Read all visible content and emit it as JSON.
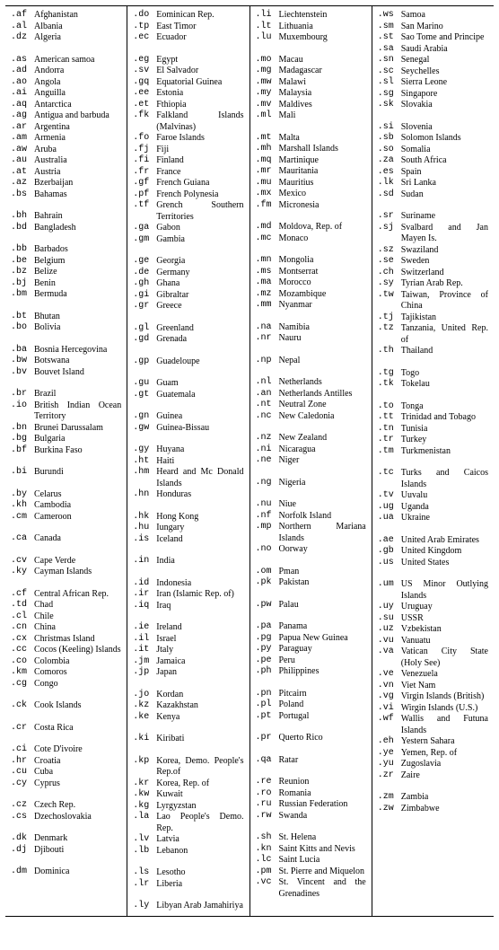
{
  "columns": [
    [
      {
        "code": ".af",
        "name": "Afghanistan"
      },
      {
        "code": ".al",
        "name": "Albania"
      },
      {
        "code": ".dz",
        "name": "Algeria"
      },
      {
        "gap": true
      },
      {
        "code": ".as",
        "name": "American samoa"
      },
      {
        "code": ".ad",
        "name": "Andorra"
      },
      {
        "code": ".ao",
        "name": "Angola"
      },
      {
        "code": ".ai",
        "name": "Anguilla"
      },
      {
        "code": ".aq",
        "name": "Antarctica"
      },
      {
        "code": ".ag",
        "name": "Antigua and bar­buda"
      },
      {
        "code": ".ar",
        "name": "Argentina"
      },
      {
        "code": ".am",
        "name": "Armenia"
      },
      {
        "code": ".aw",
        "name": "Aruba"
      },
      {
        "code": ".au",
        "name": "Australia"
      },
      {
        "code": ".at",
        "name": "Austria"
      },
      {
        "code": ".az",
        "name": "Bzerbaijan"
      },
      {
        "code": ".bs",
        "name": "Bahamas"
      },
      {
        "gap": true
      },
      {
        "code": ".bh",
        "name": "Bahrain"
      },
      {
        "code": ".bd",
        "name": "Bangladesh"
      },
      {
        "gap": true
      },
      {
        "code": ".bb",
        "name": "Barbados"
      },
      {
        "code": ".be",
        "name": "Belgium"
      },
      {
        "code": ".bz",
        "name": "Belize"
      },
      {
        "code": ".bj",
        "name": "Benin"
      },
      {
        "code": ".bm",
        "name": "Bermuda"
      },
      {
        "gap": true
      },
      {
        "code": ".bt",
        "name": "Bhutan"
      },
      {
        "code": ".bo",
        "name": "Bolivia"
      },
      {
        "gap": true
      },
      {
        "code": ".ba",
        "name": "Bosnia Hercegov­ina"
      },
      {
        "code": ".bw",
        "name": "Botswana"
      },
      {
        "code": ".bv",
        "name": "Bouvet Island"
      },
      {
        "gap": true
      },
      {
        "code": ".br",
        "name": "Brazil"
      },
      {
        "code": ".io",
        "name": "British Indian Ocean Territory"
      },
      {
        "code": ".bn",
        "name": "Brunei Darussalam"
      },
      {
        "code": ".bg",
        "name": "Bulgaria"
      },
      {
        "code": ".bf",
        "name": "Burkina Faso"
      },
      {
        "gap": true
      },
      {
        "code": ".bi",
        "name": "Burundi"
      },
      {
        "gap": true
      },
      {
        "code": ".by",
        "name": "Celarus"
      },
      {
        "code": ".kh",
        "name": "Cambodia"
      },
      {
        "code": ".cm",
        "name": "Cameroon"
      },
      {
        "gap": true
      },
      {
        "code": ".ca",
        "name": "Canada"
      },
      {
        "gap": true
      },
      {
        "code": ".cv",
        "name": "Cape Verde"
      },
      {
        "code": ".ky",
        "name": "Cayman Islands"
      },
      {
        "gap": true
      },
      {
        "code": ".cf",
        "name": "Central African Rep."
      },
      {
        "code": ".td",
        "name": "Chad"
      },
      {
        "code": ".cl",
        "name": "Chile"
      },
      {
        "code": ".cn",
        "name": "China"
      },
      {
        "code": ".cx",
        "name": "Christmas Island"
      },
      {
        "code": ".cc",
        "name": "Cocos (Keeling) Is­lands"
      },
      {
        "code": ".co",
        "name": "Colombia"
      },
      {
        "code": ".km",
        "name": "Comoros"
      },
      {
        "code": ".cg",
        "name": "Congo"
      },
      {
        "gap": true
      },
      {
        "code": ".ck",
        "name": "Cook Islands"
      },
      {
        "gap": true
      },
      {
        "code": ".cr",
        "name": "Costa Rica"
      },
      {
        "gap": true
      },
      {
        "code": ".ci",
        "name": "Cote D'ivoire"
      },
      {
        "code": ".hr",
        "name": "Croatia"
      },
      {
        "code": ".cu",
        "name": "Cuba"
      },
      {
        "code": ".cy",
        "name": "Cyprus"
      },
      {
        "gap": true
      },
      {
        "code": ".cz",
        "name": "Czech Rep."
      },
      {
        "code": ".cs",
        "name": "Dzechoslovakia"
      },
      {
        "gap": true
      },
      {
        "code": ".dk",
        "name": "Denmark"
      },
      {
        "code": ".dj",
        "name": "Djibouti"
      },
      {
        "gap": true
      },
      {
        "code": ".dm",
        "name": "Dominica"
      }
    ],
    [
      {
        "code": ".do",
        "name": "Eominican Rep."
      },
      {
        "code": ".tp",
        "name": "East Timor"
      },
      {
        "code": ".ec",
        "name": "Ecuador"
      },
      {
        "gap": true
      },
      {
        "code": ".eg",
        "name": "Egypt"
      },
      {
        "code": ".sv",
        "name": "El Salvador"
      },
      {
        "code": ".gq",
        "name": "Equatorial Guinea"
      },
      {
        "code": ".ee",
        "name": "Estonia"
      },
      {
        "code": ".et",
        "name": "Fthiopia"
      },
      {
        "code": ".fk",
        "name": "Falkland Islands (Malvinas)"
      },
      {
        "code": ".fo",
        "name": "Faroe Islands"
      },
      {
        "code": ".fj",
        "name": "Fiji"
      },
      {
        "code": ".fi",
        "name": "Finland"
      },
      {
        "code": ".fr",
        "name": "France"
      },
      {
        "code": ".gf",
        "name": "French Guiana"
      },
      {
        "code": ".pf",
        "name": "French Polynesia"
      },
      {
        "code": ".tf",
        "name": "Grench Southern Territories"
      },
      {
        "code": ".ga",
        "name": "Gabon"
      },
      {
        "code": ".gm",
        "name": "Gambia"
      },
      {
        "gap": true
      },
      {
        "code": ".ge",
        "name": "Georgia"
      },
      {
        "code": ".de",
        "name": "Germany"
      },
      {
        "code": ".gh",
        "name": "Ghana"
      },
      {
        "code": ".gi",
        "name": "Gibraltar"
      },
      {
        "code": ".gr",
        "name": "Greece"
      },
      {
        "gap": true
      },
      {
        "code": ".gl",
        "name": "Greenland"
      },
      {
        "code": ".gd",
        "name": "Grenada"
      },
      {
        "gap": true
      },
      {
        "code": ".gp",
        "name": "Guadeloupe"
      },
      {
        "gap": true
      },
      {
        "code": ".gu",
        "name": "Guam"
      },
      {
        "code": ".gt",
        "name": "Guatemala"
      },
      {
        "gap": true
      },
      {
        "code": ".gn",
        "name": "Guinea"
      },
      {
        "code": ".gw",
        "name": "Guinea-Bissau"
      },
      {
        "gap": true
      },
      {
        "code": ".gy",
        "name": "Huyana"
      },
      {
        "code": ".ht",
        "name": "Haiti"
      },
      {
        "code": ".hm",
        "name": "Heard and Mc Donald Islands"
      },
      {
        "code": ".hn",
        "name": "Honduras"
      },
      {
        "gap": true
      },
      {
        "code": ".hk",
        "name": "Hong Kong"
      },
      {
        "code": ".hu",
        "name": "Iungary"
      },
      {
        "code": ".is",
        "name": "Iceland"
      },
      {
        "gap": true
      },
      {
        "code": ".in",
        "name": "India"
      },
      {
        "gap": true
      },
      {
        "code": ".id",
        "name": "Indonesia"
      },
      {
        "code": ".ir",
        "name": "Iran (Islamic Rep. of)"
      },
      {
        "code": ".iq",
        "name": "Iraq"
      },
      {
        "gap": true
      },
      {
        "code": ".ie",
        "name": "Ireland"
      },
      {
        "code": ".il",
        "name": "Israel"
      },
      {
        "code": ".it",
        "name": "Jtaly"
      },
      {
        "code": ".jm",
        "name": "Jamaica"
      },
      {
        "code": ".jp",
        "name": "Japan"
      },
      {
        "gap": true
      },
      {
        "code": ".jo",
        "name": "Kordan"
      },
      {
        "code": ".kz",
        "name": "Kazakhstan"
      },
      {
        "code": ".ke",
        "name": "Kenya"
      },
      {
        "gap": true
      },
      {
        "code": ".ki",
        "name": "Kiribati"
      },
      {
        "gap": true
      },
      {
        "code": ".kp",
        "name": "Korea, Demo. Peo­ple's Rep.of"
      },
      {
        "code": ".kr",
        "name": "Korea, Rep. of"
      },
      {
        "code": ".kw",
        "name": "Kuwait"
      },
      {
        "code": ".kg",
        "name": "Lyrgyzstan"
      },
      {
        "code": ".la",
        "name": "Lao People's Demo. Rep."
      },
      {
        "code": ".lv",
        "name": "Latvia"
      },
      {
        "code": ".lb",
        "name": "Lebanon"
      },
      {
        "gap": true
      },
      {
        "code": ".ls",
        "name": "Lesotho"
      },
      {
        "code": ".lr",
        "name": "Liberia"
      },
      {
        "gap": true
      },
      {
        "code": ".ly",
        "name": "Libyan Arab Jamahiriya"
      }
    ],
    [
      {
        "code": ".li",
        "name": "Liechtenstein"
      },
      {
        "code": ".lt",
        "name": "Lithuania"
      },
      {
        "code": ".lu",
        "name": "Muxembourg"
      },
      {
        "gap": true
      },
      {
        "code": ".mo",
        "name": "Macau"
      },
      {
        "code": ".mg",
        "name": "Madagascar"
      },
      {
        "code": ".mw",
        "name": "Malawi"
      },
      {
        "code": ".my",
        "name": "Malaysia"
      },
      {
        "code": ".mv",
        "name": "Maldives"
      },
      {
        "code": ".ml",
        "name": "Mali"
      },
      {
        "gap": true
      },
      {
        "code": ".mt",
        "name": "Malta"
      },
      {
        "code": ".mh",
        "name": "Marshall Islands"
      },
      {
        "code": ".mq",
        "name": "Martinique"
      },
      {
        "code": ".mr",
        "name": "Mauritania"
      },
      {
        "code": ".mu",
        "name": "Mauritius"
      },
      {
        "code": ".mx",
        "name": "Mexico"
      },
      {
        "code": ".fm",
        "name": "Micronesia"
      },
      {
        "gap": true
      },
      {
        "code": ".md",
        "name": "Moldova, Rep. of"
      },
      {
        "code": ".mc",
        "name": "Monaco"
      },
      {
        "gap": true
      },
      {
        "code": ".mn",
        "name": "Mongolia"
      },
      {
        "code": ".ms",
        "name": "Montserrat"
      },
      {
        "code": ".ma",
        "name": "Morocco"
      },
      {
        "code": ".mz",
        "name": "Mozambique"
      },
      {
        "code": ".mm",
        "name": "Nyanmar"
      },
      {
        "gap": true
      },
      {
        "code": ".na",
        "name": "Namibia"
      },
      {
        "code": ".nr",
        "name": "Nauru"
      },
      {
        "gap": true
      },
      {
        "code": ".np",
        "name": "Nepal"
      },
      {
        "gap": true
      },
      {
        "code": ".nl",
        "name": "Netherlands"
      },
      {
        "code": ".an",
        "name": "Netherlands An­tilles"
      },
      {
        "code": ".nt",
        "name": "Neutral Zone"
      },
      {
        "code": ".nc",
        "name": "New Caledonia"
      },
      {
        "gap": true
      },
      {
        "code": ".nz",
        "name": "New Zealand"
      },
      {
        "code": ".ni",
        "name": "Nicaragua"
      },
      {
        "code": ".ne",
        "name": "Niger"
      },
      {
        "gap": true
      },
      {
        "code": ".ng",
        "name": "Nigeria"
      },
      {
        "gap": true
      },
      {
        "code": ".nu",
        "name": "Niue"
      },
      {
        "code": ".nf",
        "name": "Norfolk Island"
      },
      {
        "code": ".mp",
        "name": "Northern Mariana Islands"
      },
      {
        "code": ".no",
        "name": "Oorway"
      },
      {
        "gap": true
      },
      {
        "code": ".om",
        "name": "Pman"
      },
      {
        "code": ".pk",
        "name": "Pakistan"
      },
      {
        "gap": true
      },
      {
        "code": ".pw",
        "name": "Palau"
      },
      {
        "gap": true
      },
      {
        "code": ".pa",
        "name": "Panama"
      },
      {
        "code": ".pg",
        "name": "Papua New Guinea"
      },
      {
        "code": ".py",
        "name": "Paraguay"
      },
      {
        "code": ".pe",
        "name": "Peru"
      },
      {
        "code": ".ph",
        "name": "Philippines"
      },
      {
        "gap": true
      },
      {
        "code": ".pn",
        "name": "Pitcairn"
      },
      {
        "code": ".pl",
        "name": "Poland"
      },
      {
        "code": ".pt",
        "name": "Portugal"
      },
      {
        "gap": true
      },
      {
        "code": ".pr",
        "name": "Querto Rico"
      },
      {
        "gap": true
      },
      {
        "code": ".qa",
        "name": "Ratar"
      },
      {
        "gap": true
      },
      {
        "code": ".re",
        "name": "Reunion"
      },
      {
        "code": ".ro",
        "name": "Romania"
      },
      {
        "code": ".ru",
        "name": "Russian Federation"
      },
      {
        "code": ".rw",
        "name": "Swanda"
      },
      {
        "gap": true
      },
      {
        "code": ".sh",
        "name": "St. Helena"
      },
      {
        "code": ".kn",
        "name": "Saint Kitts and Nevis"
      },
      {
        "code": ".lc",
        "name": "Saint Lucia"
      },
      {
        "code": ".pm",
        "name": "St. Pierre and Miquelon"
      },
      {
        "code": ".vc",
        "name": "St. Vincent and the Grenadines"
      }
    ],
    [
      {
        "code": ".ws",
        "name": "Samoa"
      },
      {
        "code": ".sm",
        "name": "San Marino"
      },
      {
        "code": ".st",
        "name": "Sao Tome and Principe"
      },
      {
        "code": ".sa",
        "name": "Saudi Arabia"
      },
      {
        "code": ".sn",
        "name": "Senegal"
      },
      {
        "code": ".sc",
        "name": "Seychelles"
      },
      {
        "code": ".sl",
        "name": "Sierra Leone"
      },
      {
        "code": ".sg",
        "name": "Singapore"
      },
      {
        "code": ".sk",
        "name": "Slovakia"
      },
      {
        "gap": true
      },
      {
        "code": ".si",
        "name": "Slovenia"
      },
      {
        "code": ".sb",
        "name": "Solomon Islands"
      },
      {
        "code": ".so",
        "name": "Somalia"
      },
      {
        "code": ".za",
        "name": "South Africa"
      },
      {
        "code": ".es",
        "name": "Spain"
      },
      {
        "code": ".lk",
        "name": "Sri Lanka"
      },
      {
        "code": ".sd",
        "name": "Sudan"
      },
      {
        "gap": true
      },
      {
        "code": ".sr",
        "name": "Suriname"
      },
      {
        "code": ".sj",
        "name": "Svalbard and Jan Mayen Is."
      },
      {
        "code": ".sz",
        "name": "Swaziland"
      },
      {
        "code": ".se",
        "name": "Sweden"
      },
      {
        "code": ".ch",
        "name": "Switzerland"
      },
      {
        "code": ".sy",
        "name": "Tyrian Arab Rep."
      },
      {
        "code": ".tw",
        "name": "Taiwan, Province of China"
      },
      {
        "code": ".tj",
        "name": "Tajikistan"
      },
      {
        "code": ".tz",
        "name": "Tanzania, United Rep. of"
      },
      {
        "code": ".th",
        "name": "Thailand"
      },
      {
        "gap": true
      },
      {
        "code": ".tg",
        "name": "Togo"
      },
      {
        "code": ".tk",
        "name": "Tokelau"
      },
      {
        "gap": true
      },
      {
        "code": ".to",
        "name": "Tonga"
      },
      {
        "code": ".tt",
        "name": "Trinidad and To­bago"
      },
      {
        "code": ".tn",
        "name": "Tunisia"
      },
      {
        "code": ".tr",
        "name": "Turkey"
      },
      {
        "code": ".tm",
        "name": "Turkmenistan"
      },
      {
        "gap": true
      },
      {
        "code": ".tc",
        "name": "Turks and Caicos Islands"
      },
      {
        "code": ".tv",
        "name": "Uuvalu"
      },
      {
        "code": ".ug",
        "name": "Uganda"
      },
      {
        "code": ".ua",
        "name": "Ukraine"
      },
      {
        "gap": true
      },
      {
        "code": ".ae",
        "name": "United Arab Emi­rates"
      },
      {
        "code": ".gb",
        "name": "United Kingdom"
      },
      {
        "code": ".us",
        "name": "United States"
      },
      {
        "gap": true
      },
      {
        "code": ".um",
        "name": "US Minor Outlying Islands"
      },
      {
        "code": ".uy",
        "name": "Uruguay"
      },
      {
        "code": ".su",
        "name": "USSR"
      },
      {
        "code": ".uz",
        "name": "Vzbekistan"
      },
      {
        "code": ".vu",
        "name": "Vanuatu"
      },
      {
        "code": ".va",
        "name": "Vatican City State (Holy See)"
      },
      {
        "code": ".ve",
        "name": "Venezuela"
      },
      {
        "code": ".vn",
        "name": "Viet Nam"
      },
      {
        "code": ".vg",
        "name": "Virgin Islands (British)"
      },
      {
        "code": ".vi",
        "name": "Wirgin Islands (U.S.)"
      },
      {
        "code": ".wf",
        "name": "Wallis and Futuna Islands"
      },
      {
        "code": ".eh",
        "name": "Yestern Sahara"
      },
      {
        "code": ".ye",
        "name": "Yemen, Rep. of"
      },
      {
        "code": ".yu",
        "name": "Zugoslavia"
      },
      {
        "code": ".zr",
        "name": "Zaire"
      },
      {
        "gap": true
      },
      {
        "code": ".zm",
        "name": "Zambia"
      },
      {
        "code": ".zw",
        "name": "Zimbabwe"
      }
    ]
  ]
}
